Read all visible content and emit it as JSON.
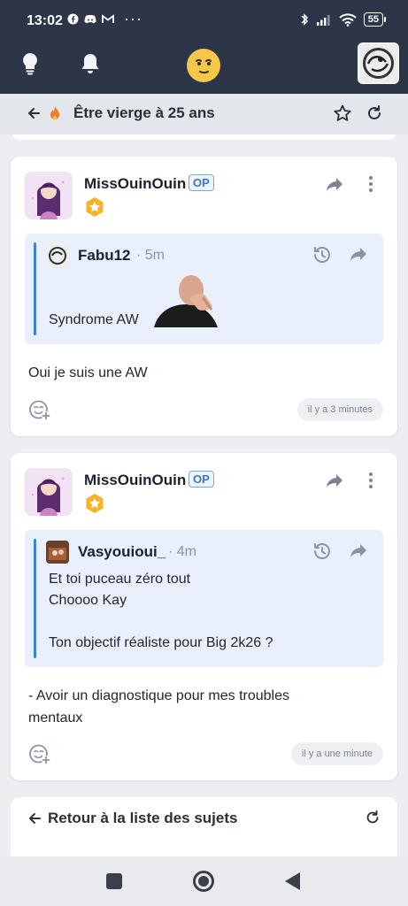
{
  "status_bar": {
    "time": "13:02",
    "battery": "55"
  },
  "topic": {
    "title": "Être vierge à 25 ans"
  },
  "posts": [
    {
      "author": "MissOuinOuin",
      "op_badge": "OP",
      "quote": {
        "author": "Fabu12",
        "time": "5m",
        "text": "Syndrome AW"
      },
      "message": "Oui je suis une AW",
      "timestamp": "il y a 3 minutes"
    },
    {
      "author": "MissOuinOuin",
      "op_badge": "OP",
      "quote": {
        "author": "Vasyouioui_",
        "time": "4m",
        "lines": [
          "Et toi puceau zéro tout",
          "Choooo Kay",
          "",
          "Ton objectif réaliste pour Big 2k26 ?"
        ]
      },
      "message_lines": [
        "- Avoir un diagnostique pour mes troubles",
        "mentaux"
      ],
      "timestamp": "il y a une minute"
    }
  ],
  "footer": {
    "back_label": "Retour à la liste des sujets"
  },
  "colors": {
    "header_bg": "#2d3648",
    "accent_blue": "#3b82d8",
    "quote_bg": "#eaf0fb"
  }
}
